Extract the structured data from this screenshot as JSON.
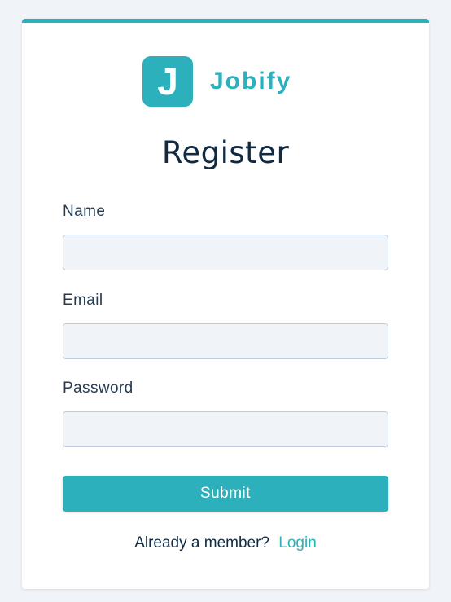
{
  "brand": {
    "logo_letter": "J",
    "name": "Jobify",
    "color": "#2cb1bc"
  },
  "form": {
    "title": "Register",
    "fields": [
      {
        "label": "Name",
        "value": ""
      },
      {
        "label": "Email",
        "value": ""
      },
      {
        "label": "Password",
        "value": ""
      }
    ],
    "submit_label": "Submit",
    "member_prompt": "Already a member?",
    "login_link": "Login"
  }
}
